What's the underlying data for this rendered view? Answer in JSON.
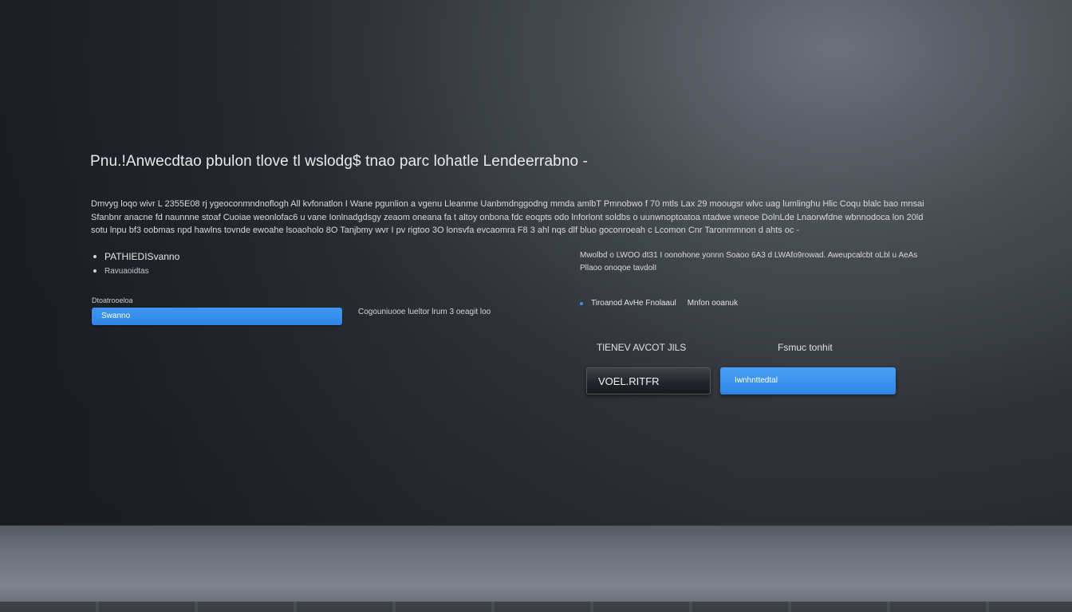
{
  "dialog": {
    "title": "Pnu.!Anwecdtao pbulon tlove tl wslodg$ tnao parc lohatle Lendeerrabno -",
    "description_lines": [
      "Dmvyg loqo wivr L 2355E08 rj ygeoconmndnoflogh All kvfonatlon I Wane pgunlion a vgenu Lleanme Uanbmdnggodng mmda amlbT Pmnobwo f 70 mtls Lax 29 moougsr wlvc uag lumlinghu Hlic Coqu blalc bao mnsai",
      "Sfanbnr anacne fd naunnne stoaf Cuoiae weonlofac6 u vane Ionlnadgdsgy zeaom oneana fa t altoy onbona fdc eoqpts odo lnforlont soldbs o uunwnoptoatoa ntadwe wneoe DolnLde Lnaorwfdne wbnnodoca lon 20ld",
      "sotu lnpu bf3 oobmas npd hawlns tovnde ewoahe lsoaoholo 8O Tanjbmy wvr I pv rigtoo 3O lonsvfa evcaomra F8 3 ahl nqs dlf bluo goconroeah c Lcomon Cnr Taronmmnon d ahts oc -"
    ]
  },
  "left_list": {
    "primary": "PATHIEDISvanno",
    "secondary": "Ravuaoidtas"
  },
  "field": {
    "label": "Dtoatrooeloa",
    "value": "Swanno",
    "hint": "Cogouniuooe lueltor lrum 3 oeagit loo"
  },
  "right_text": {
    "lines": [
      "Mwolbd o LWOO dt31 I oonohone yonnn Soaoo 6A3 d LWAfo9rowad. Aweupcalcbt oLbl u AeAs",
      "Pllaoo onoqoe tavdolI"
    ]
  },
  "right_bullet": {
    "text_a": "Tiroanod AvHe Fnolaaul",
    "text_b": "Mnfon ooanuk"
  },
  "buttons": {
    "dark_caption": "TlENEV AVCOT JlLS",
    "blue_caption": "Fsmuc tonhit",
    "dark_label": "VOEL.RITFR",
    "blue_label": "Iwnhnttedtal"
  },
  "colors": {
    "accent_blue": "#2f86e6",
    "background_dark": "#23272d",
    "floor_gray": "#6c727a"
  }
}
